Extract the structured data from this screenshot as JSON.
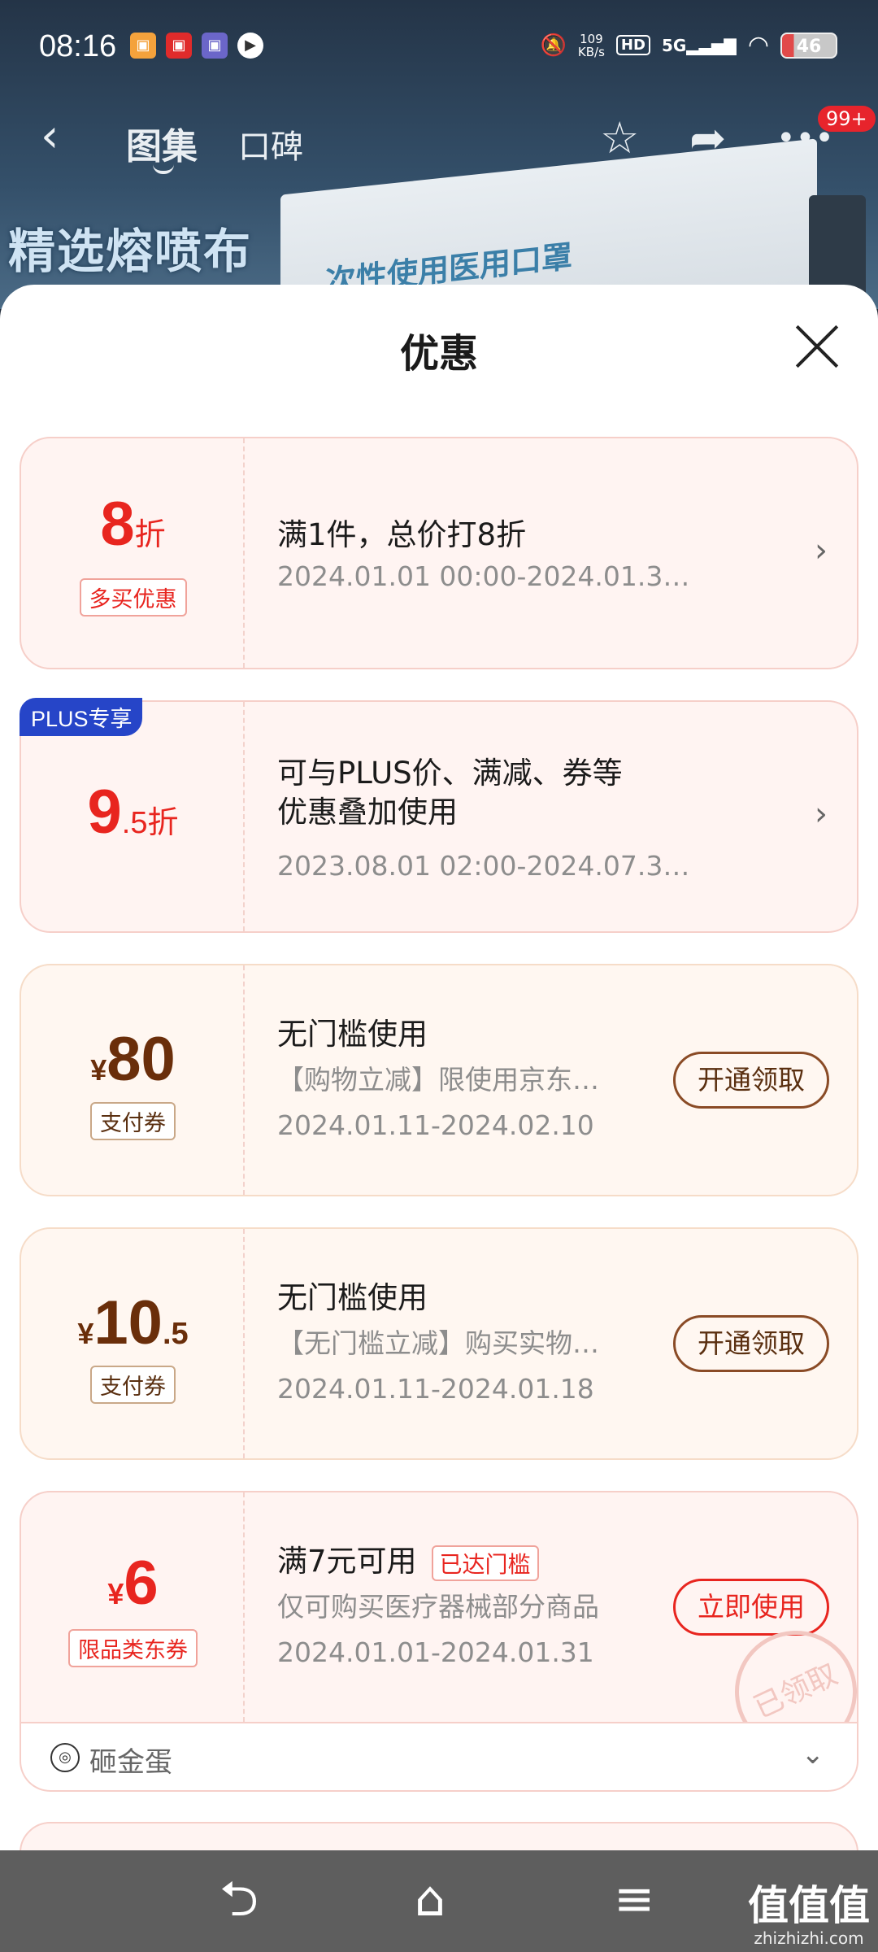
{
  "background": {
    "banner_text": "精选熔喷布",
    "box_text": "次性使用医用口罩"
  },
  "status_bar": {
    "time": "08:16",
    "net_speed_value": "109",
    "net_speed_unit": "KB/s",
    "hd": "HD",
    "signal": "5G",
    "battery": "46"
  },
  "nav": {
    "tab_active": "图集",
    "tab_second": "口碑",
    "badge": "99+"
  },
  "sheet": {
    "title": "优惠"
  },
  "coupons": [
    {
      "big_main": "8",
      "big_unit": "折",
      "tag": "多买优惠",
      "title": "满1件，总价打8折",
      "sub": "2024.01.01 00:00-2024.01.3…"
    },
    {
      "badge": "PLUS专享",
      "big_main": "9",
      "big_unit": ".5折",
      "title_line1": "可与PLUS价、满减、券等",
      "title_line2": "优惠叠加使用",
      "sub": "2023.08.01 02:00-2024.07.3…"
    },
    {
      "currency": "¥",
      "big_main": "80",
      "tag": "支付券",
      "title": "无门槛使用",
      "desc": "【购物立减】限使用京东…",
      "sub": "2024.01.11-2024.02.10",
      "button": "开通领取"
    },
    {
      "currency": "¥",
      "big_main": "10",
      "big_unit": ".5",
      "tag": "支付券",
      "title": "无门槛使用",
      "desc": "【无门槛立减】购买实物…",
      "sub": "2024.01.11-2024.01.18",
      "button": "开通领取"
    },
    {
      "currency": "¥",
      "big_main": "6",
      "tag": "限品类东券",
      "title": "满7元可用",
      "reached": "已达门槛",
      "desc": "仅可购买医疗器械部分商品",
      "sub": "2024.01.01-2024.01.31",
      "button": "立即使用",
      "stamp": "已领取",
      "footer": "砸金蛋"
    }
  ],
  "watermark": {
    "main": "值值值",
    "url": "zhizhizhi.com"
  }
}
